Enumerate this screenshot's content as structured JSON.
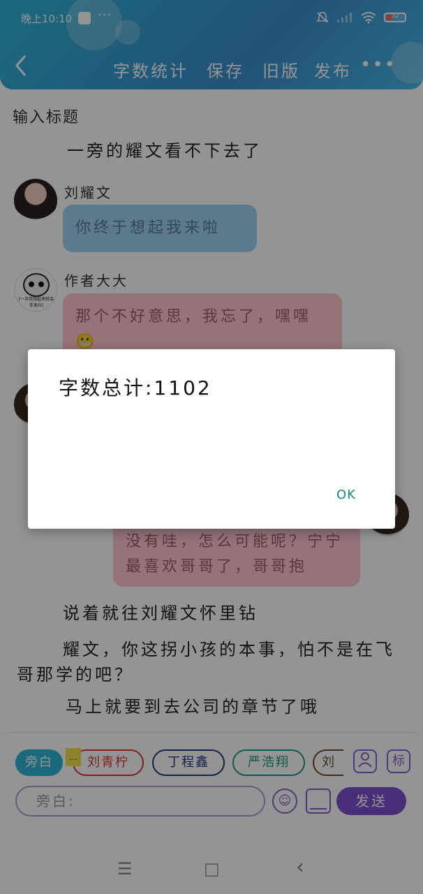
{
  "status_bar": {
    "time": "晚上10:10",
    "more": "···",
    "battery": "32",
    "battery_level": 0.32
  },
  "toolbar": {
    "word_count": "字数统计",
    "save": "保存",
    "old_version": "旧版",
    "publish": "发布",
    "more": "•••"
  },
  "editor": {
    "title_placeholder": "输入标题",
    "lines": [
      {
        "type": "narration",
        "text": "一旁的耀文看不下去了"
      },
      {
        "type": "message",
        "speaker": "刘耀文",
        "text": "你终于想起我来啦",
        "color": "#9fd3f5"
      },
      {
        "type": "message",
        "speaker": "作者大大",
        "text": "那个不好意思，我忘了，嘿嘿😬",
        "color": "#ffc9cf"
      },
      {
        "type": "message",
        "speaker": "",
        "text": "没有哇，怎么可能呢？宁宁最喜欢哥哥了，哥哥抱",
        "color": "#ffc9cf"
      },
      {
        "type": "narration",
        "text": "说着就往刘耀文怀里钻"
      },
      {
        "type": "narration",
        "text": "耀文，你这拐小孩的本事，怕不是在飞哥那学的吧？"
      },
      {
        "type": "narration",
        "text": "马上就要到去公司的章节了哦"
      }
    ]
  },
  "author_avatar_caption": "[一旦我想起来就会手发抖]",
  "characters": {
    "aside": "旁白",
    "sticky": "…",
    "liu": "刘青柠",
    "ding": "丁程鑫",
    "yan": "严浩翔",
    "more": "刘"
  },
  "input": {
    "placeholder": "旁白:",
    "send": "发送",
    "person_icon": "person-icon",
    "label_icon_text": "标"
  },
  "nav": {
    "menu": "☰",
    "home": "□",
    "back": "‹"
  },
  "dialog": {
    "message": "字数总计:1102",
    "ok": "OK"
  }
}
